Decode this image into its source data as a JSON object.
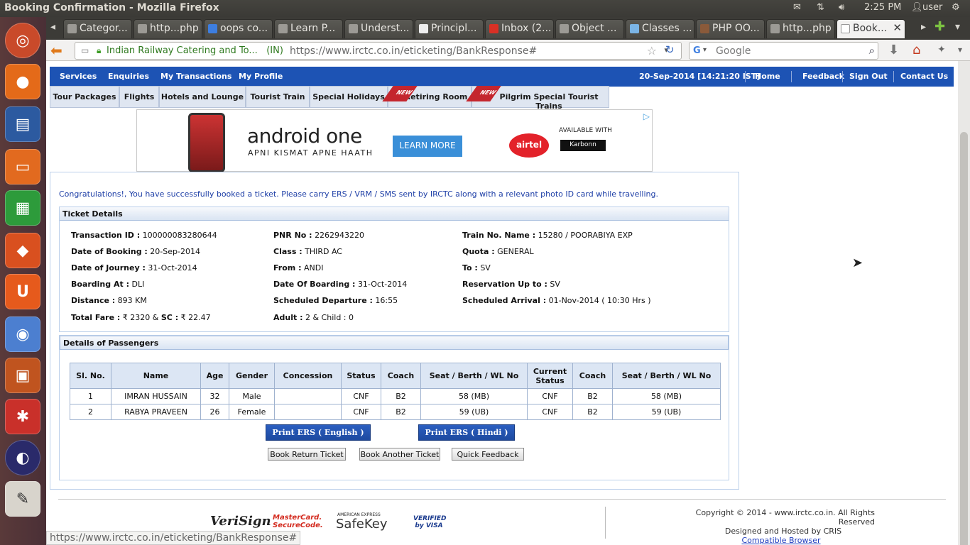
{
  "window": {
    "title": "Booking Confirmation - Mozilla Firefox"
  },
  "top_panel": {
    "time": "2:25 PM",
    "user": "user"
  },
  "tabs": [
    {
      "label": "Categor..."
    },
    {
      "label": "http...php"
    },
    {
      "label": "oops co..."
    },
    {
      "label": "Learn P..."
    },
    {
      "label": "Underst..."
    },
    {
      "label": "Principl..."
    },
    {
      "label": "Inbox (2..."
    },
    {
      "label": "Object ..."
    },
    {
      "label": "Classes ..."
    },
    {
      "label": "PHP OO..."
    },
    {
      "label": "http...php"
    },
    {
      "label": "Book..."
    }
  ],
  "urlbar": {
    "identity": "Indian Railway Catering and To...",
    "country": "(IN)",
    "url": "https://www.irctc.co.in/eticketing/BankResponse#"
  },
  "searchbar": {
    "placeholder": "Google",
    "engine": "G"
  },
  "menubar": {
    "items": [
      "Services",
      "Enquiries",
      "My Transactions",
      "My Profile"
    ],
    "datetime": "20-Sep-2014 [14:21:20 IST]",
    "right_items": [
      "Home",
      "Feedback",
      "Sign Out",
      "Contact Us"
    ]
  },
  "subtabs": [
    "Tour Packages",
    "Flights",
    "Hotels and Lounge",
    "Tourist Train",
    "Special Holidays",
    "Retiring Room",
    "Pilgrim Special Tourist Trains"
  ],
  "new_badge": "NEW",
  "ad": {
    "brand": "android one",
    "tagline": "APNI KISMAT APNE HAATH",
    "cta": "LEARN MORE",
    "partner": "airtel",
    "available": "AVAILABLE WITH",
    "karbonn": "Karbonn"
  },
  "congrats": "Congratulations!, You have successfully booked a ticket. Please carry ERS / VRM / SMS sent by IRCTC along with a relevant photo ID card while travelling.",
  "ticket": {
    "heading": "Ticket Details",
    "transaction_id": {
      "label": "Transaction ID :",
      "value": "100000083280644"
    },
    "pnr": {
      "label": "PNR No :",
      "value": "2262943220"
    },
    "train": {
      "label": "Train No. Name :",
      "value": "15280 / POORABIYA EXP"
    },
    "date_booking": {
      "label": "Date of Booking :",
      "value": "20-Sep-2014"
    },
    "class": {
      "label": "Class :",
      "value": "THIRD AC"
    },
    "quota": {
      "label": "Quota :",
      "value": "GENERAL"
    },
    "date_journey": {
      "label": "Date of Journey :",
      "value": "31-Oct-2014"
    },
    "from": {
      "label": "From :",
      "value": "ANDI"
    },
    "to": {
      "label": "To :",
      "value": "SV"
    },
    "boarding_at": {
      "label": "Boarding At :",
      "value": "DLI"
    },
    "date_boarding": {
      "label": "Date Of Boarding :",
      "value": "31-Oct-2014"
    },
    "reservation_upto": {
      "label": "Reservation Up to :",
      "value": "SV"
    },
    "distance": {
      "label": "Distance :",
      "value": "893 KM"
    },
    "sched_departure": {
      "label": "Scheduled Departure :",
      "value": "16:55"
    },
    "sched_arrival": {
      "label": "Scheduled Arrival :",
      "value": "01-Nov-2014 ( 10:30 Hrs )"
    },
    "total_fare_label": "Total Fare :",
    "total_fare_value": "₹ 2320",
    "sc_label": "SC :",
    "sc_value": "₹ 22.47",
    "adult_label": "Adult :",
    "adult_value": "2 & Child : 0"
  },
  "passengers": {
    "heading": "Details of Passengers",
    "columns": [
      "Sl. No.",
      "Name",
      "Age",
      "Gender",
      "Concession",
      "Status",
      "Coach",
      "Seat / Berth / WL No",
      "Current Status",
      "Coach",
      "Seat / Berth / WL No"
    ],
    "rows": [
      [
        "1",
        "IMRAN HUSSAIN",
        "32",
        "Male",
        "",
        "CNF",
        "B2",
        "58 (MB)",
        "CNF",
        "B2",
        "58 (MB)"
      ],
      [
        "2",
        "RABYA PRAVEEN",
        "26",
        "Female",
        "",
        "CNF",
        "B2",
        "59 (UB)",
        "CNF",
        "B2",
        "59 (UB)"
      ]
    ]
  },
  "buttons": {
    "print_en": "Print ERS ( English )",
    "print_hi": "Print ERS ( Hindi )",
    "book_return": "Book Return Ticket",
    "book_another": "Book Another Ticket",
    "quick_feedback": "Quick Feedback"
  },
  "footer": {
    "logos": [
      "VeriSign",
      "MasterCard. SecureCode.",
      "SafeKey",
      "VERIFIED by VISA"
    ],
    "amex": "AMERICAN EXPRESS",
    "copyright": "Copyright © 2014 - www.irctc.co.in. All Rights Reserved",
    "hosted": "Designed and Hosted by CRIS",
    "compat": "Compatible Browser"
  },
  "status_url": "https://www.irctc.co.in/eticketing/BankResponse#"
}
